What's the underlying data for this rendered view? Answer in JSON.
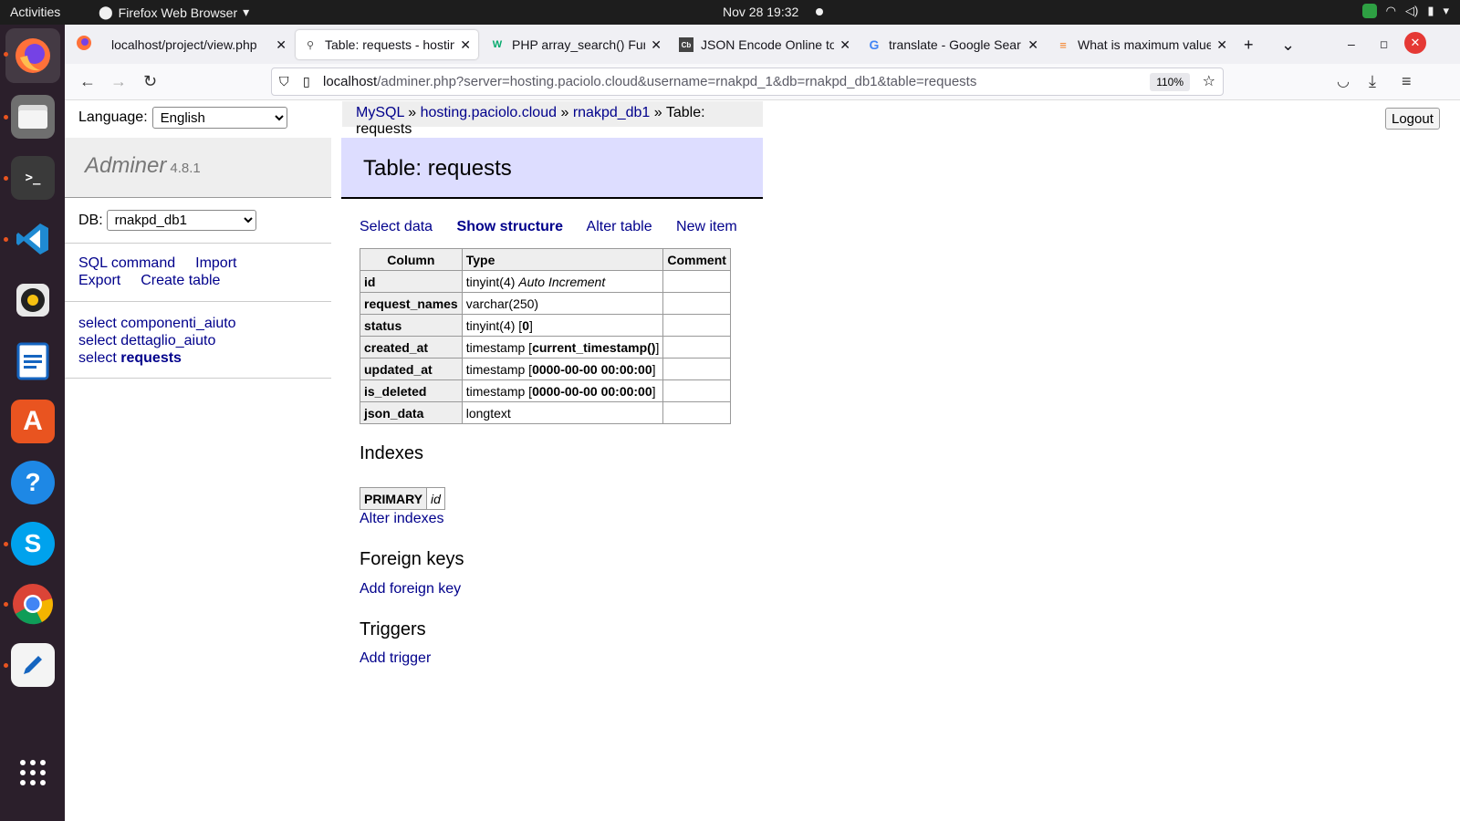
{
  "system": {
    "activities": "Activities",
    "app_name": "Firefox Web Browser",
    "clock": "Nov 28  19:32"
  },
  "browser": {
    "tabs": [
      {
        "title": "localhost/project/view.php",
        "favicon": "firefox"
      },
      {
        "title": "Table: requests - hosting",
        "favicon": "adminer"
      },
      {
        "title": "PHP array_search() Fun",
        "favicon": "w3"
      },
      {
        "title": "JSON Encode Online to",
        "favicon": "cb"
      },
      {
        "title": "translate - Google Sear",
        "favicon": "google"
      },
      {
        "title": "What is maximum value",
        "favicon": "stackoverflow"
      }
    ],
    "url_host": "localhost",
    "url_rest": "/adminer.php?server=hosting.paciolo.cloud&username=rnakpd_1&db=rnakpd_db1&table=requests",
    "zoom": "110%"
  },
  "adminer": {
    "language_label": "Language:",
    "language_value": "English",
    "app_name": "Adminer",
    "version": "4.8.1",
    "db_label": "DB:",
    "db_value": "rnakpd_db1",
    "links": {
      "sql": "SQL command",
      "import": "Import",
      "export": "Export",
      "create": "Create table"
    },
    "tables": [
      {
        "prefix": "select",
        "name": "componenti_aiuto"
      },
      {
        "prefix": "select",
        "name": "dettaglio_aiuto"
      },
      {
        "prefix": "select",
        "name": "requests"
      }
    ],
    "breadcrumb": {
      "engine": "MySQL",
      "sep": "»",
      "server": "hosting.paciolo.cloud",
      "db": "rnakpd_db1",
      "current": "Table: requests"
    },
    "title": "Table: requests",
    "actions": {
      "select": "Select data",
      "structure": "Show structure",
      "alter": "Alter table",
      "new": "New item"
    },
    "structure": {
      "headers": [
        "Column",
        "Type",
        "Comment"
      ],
      "rows": [
        {
          "column": "id",
          "type": "tinyint(4)",
          "extra": "Auto Increment",
          "default": ""
        },
        {
          "column": "request_names",
          "type": "varchar(250)",
          "extra": "",
          "default": ""
        },
        {
          "column": "status",
          "type": "tinyint(4)",
          "extra": "",
          "default": "0"
        },
        {
          "column": "created_at",
          "type": "timestamp",
          "extra": "",
          "default": "current_timestamp()"
        },
        {
          "column": "updated_at",
          "type": "timestamp",
          "extra": "",
          "default": "0000-00-00 00:00:00"
        },
        {
          "column": "is_deleted",
          "type": "timestamp",
          "extra": "",
          "default": "0000-00-00 00:00:00"
        },
        {
          "column": "json_data",
          "type": "longtext",
          "extra": "",
          "default": ""
        }
      ]
    },
    "indexes": {
      "heading": "Indexes",
      "type": "PRIMARY",
      "column": "id",
      "alter_link": "Alter indexes"
    },
    "foreign_keys": {
      "heading": "Foreign keys",
      "link": "Add foreign key"
    },
    "triggers": {
      "heading": "Triggers",
      "link": "Add trigger"
    },
    "logout": "Logout"
  }
}
